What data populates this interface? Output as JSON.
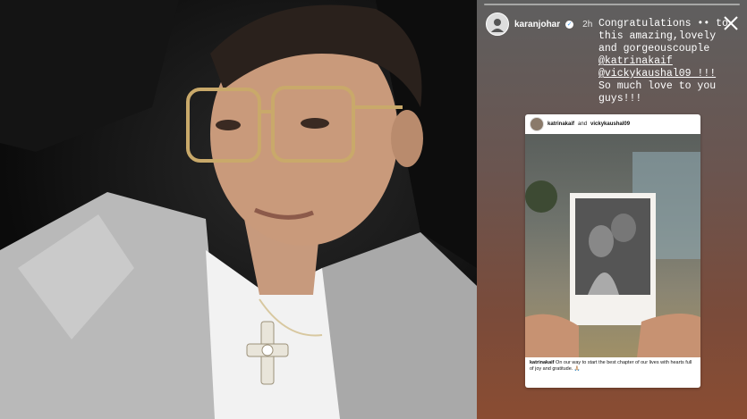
{
  "story": {
    "username": "karanjohar",
    "time": "2h",
    "caption_lines": [
      "Congratulations •• to",
      "this amazing,lovely",
      "and gorgeouscouple"
    ],
    "mentions": [
      "@katrinakaif",
      "@vickykaushal09 !!!"
    ],
    "closing_lines": [
      "So much love to you",
      "guys!!!"
    ]
  },
  "post": {
    "user1": "katrinakaif",
    "joiner": "and",
    "user2": "vickykaushal09",
    "caption_user": "katrinakaif",
    "caption_text": "On our way to start the best chapter of our lives with hearts full of joy and gratitude. 🙏🏼"
  },
  "colors": {
    "verified": "#3897f0",
    "story_bottom": "#8a4c32"
  },
  "icons": [
    "verified-icon",
    "close-icon"
  ]
}
